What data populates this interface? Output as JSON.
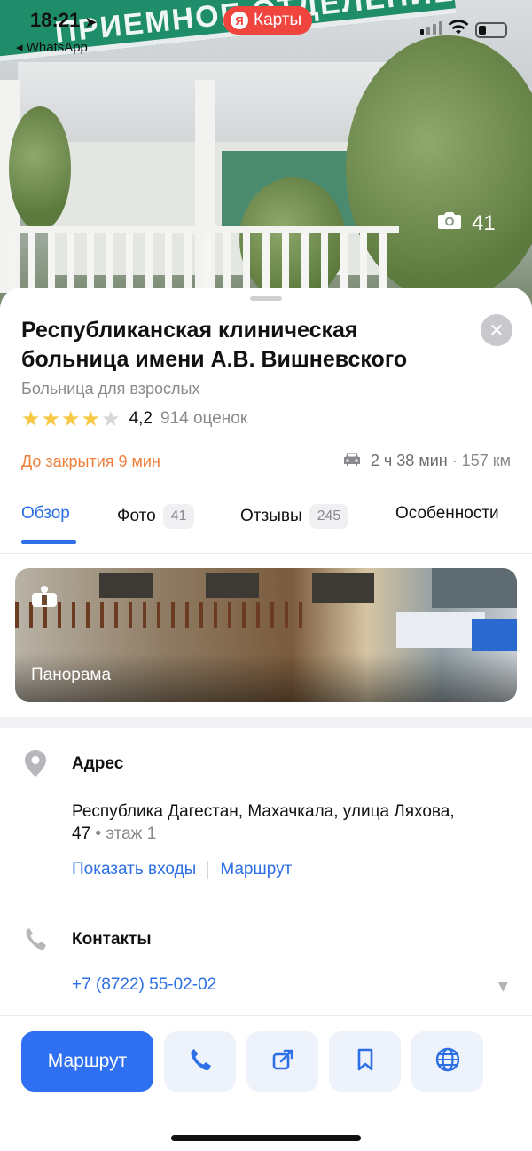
{
  "status_bar": {
    "time": "18:21",
    "back_app": "◂ WhatsApp",
    "app_pill": "Карты",
    "app_pill_logo": "Я"
  },
  "hero": {
    "sign_text": "ПРИЕМНОЕ ОТДЕЛЕНИЕ",
    "photo_count": "41"
  },
  "place": {
    "title": "Республиканская клиническая больница имени А.В. Вишневского",
    "category": "Больница для взрослых",
    "rating_value": "4,2",
    "rating_stars_filled": 4,
    "rating_stars_total": 5,
    "rating_count": "914 оценок",
    "closing": "До закрытия 9 мин",
    "travel_time": "2 ч 38 мин",
    "travel_distance": "· 157 км"
  },
  "tabs": [
    {
      "label": "Обзор",
      "badge": ""
    },
    {
      "label": "Фото",
      "badge": "41"
    },
    {
      "label": "Отзывы",
      "badge": "245"
    },
    {
      "label": "Особенности",
      "badge": ""
    }
  ],
  "panorama": {
    "label": "Панорама"
  },
  "address": {
    "heading": "Адрес",
    "line1": "Республика Дагестан, Махачкала, улица Ляхова,",
    "line2": "47",
    "floor": " • этаж 1",
    "link_entrances": "Показать входы",
    "link_route": "Маршрут"
  },
  "contacts": {
    "heading": "Контакты",
    "phone": "+7 (8722) 55-02-02"
  },
  "actions": {
    "route_label": "Маршрут",
    "icons": [
      "phone-icon",
      "share-icon",
      "bookmark-icon",
      "globe-icon"
    ]
  },
  "colors": {
    "accent": "#2d6fe4",
    "route_button": "#2f6ff1",
    "closing_orange": "#ef7f3a",
    "star": "#f7c843",
    "maps_red": "#f0443e"
  }
}
